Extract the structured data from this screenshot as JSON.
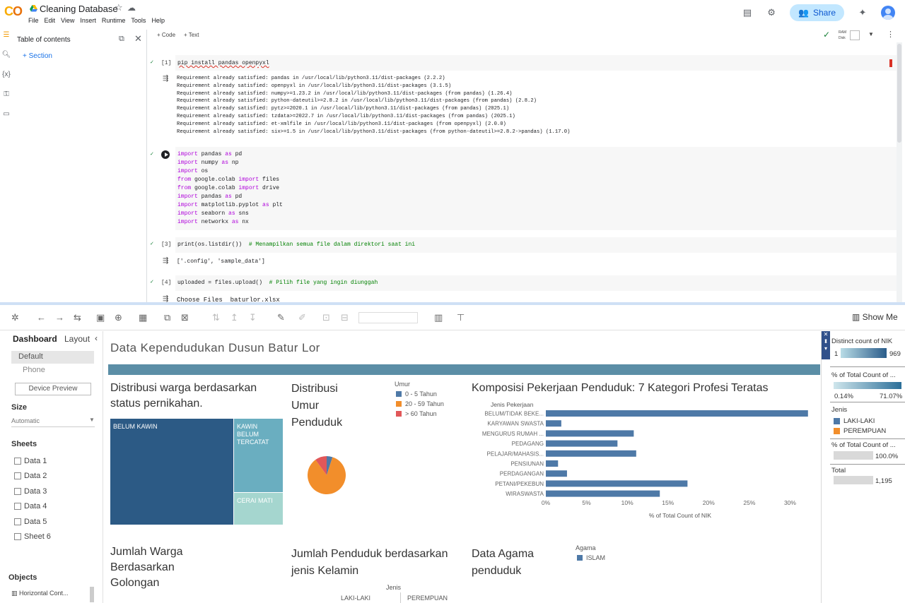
{
  "colab": {
    "title": "Cleaning Database",
    "menu": [
      "File",
      "Edit",
      "View",
      "Insert",
      "Runtime",
      "Tools",
      "Help"
    ],
    "share_label": "Share",
    "toc": {
      "title": "Table of contents",
      "section": "+ Section"
    },
    "toolbar": {
      "add_code": "+ Code",
      "add_text": "+ Text",
      "ram": "RAM",
      "disk": "Disk"
    },
    "cells": [
      {
        "number": "[1]",
        "ran": "✓",
        "code": [
          "pip install pandas openpyxl"
        ],
        "output": [
          "Requirement already satisfied: pandas in /usr/local/lib/python3.11/dist-packages (2.2.2)",
          "Requirement already satisfied: openpyxl in /usr/local/lib/python3.11/dist-packages (3.1.5)",
          "Requirement already satisfied: numpy>=1.23.2 in /usr/local/lib/python3.11/dist-packages (from pandas) (1.26.4)",
          "Requirement already satisfied: python-dateutil>=2.8.2 in /usr/local/lib/python3.11/dist-packages (from pandas) (2.8.2)",
          "Requirement already satisfied: pytz>=2020.1 in /usr/local/lib/python3.11/dist-packages (from pandas) (2025.1)",
          "Requirement already satisfied: tzdata>=2022.7 in /usr/local/lib/python3.11/dist-packages (from pandas) (2025.1)",
          "Requirement already satisfied: et-xmlfile in /usr/local/lib/python3.11/dist-packages (from openpyxl) (2.0.0)",
          "Requirement already satisfied: six>=1.5 in /usr/local/lib/python3.11/dist-packages (from python-dateutil>=2.8.2->pandas) (1.17.0)"
        ]
      },
      {
        "number": "",
        "ran": "✓",
        "code": [
          "import pandas as pd",
          "import numpy as np",
          "import os",
          "from google.colab import files",
          "from google.colab import drive",
          "import pandas as pd",
          "import matplotlib.pyplot as plt",
          "import seaborn as sns",
          "import networkx as nx"
        ],
        "output": []
      },
      {
        "number": "[3]",
        "ran": "✓",
        "code": [
          "print(os.listdir())  # Menampilkan semua file dalam direktori saat ini"
        ],
        "output": [
          "['.config', 'sample_data']"
        ]
      },
      {
        "number": "[4]",
        "ran": "✓",
        "code": [
          "uploaded = files.upload()  # Pilih file yang ingin diunggah"
        ],
        "output": [
          "Choose Files  baturlor.xlsx"
        ]
      }
    ]
  },
  "tableau": {
    "show_me": "Show Me",
    "tabs": {
      "dashboard": "Dashboard",
      "layout": "Layout"
    },
    "device": {
      "default": "Default",
      "phone": "Phone",
      "preview": "Device Preview"
    },
    "size": {
      "label": "Size",
      "value": "Automatic"
    },
    "sheets_label": "Sheets",
    "sheets": [
      "Data 1",
      "Data 2",
      "Data 3",
      "Data 4",
      "Data 5",
      "Sheet 6"
    ],
    "objects_label": "Objects",
    "objects_item": "Horizontal Cont...",
    "dashboard_title": "Data Kependudukan Dusun Batur Lor",
    "sections": {
      "marital": "Distribusi warga berdasarkan status pernikahan.",
      "age": "Distribusi Umur Penduduk",
      "occupation": "Komposisi Pekerjaan Penduduk: 7 Kategori Profesi Teratas",
      "education": "Jumlah Warga Berdasarkan Golongan",
      "gender": "Jumlah Penduduk berdasarkan jenis Kelamin",
      "religion": "Data Agama penduduk"
    },
    "treemap": [
      {
        "label": "BELUM KAWIN",
        "color": "#2c5a85"
      },
      {
        "label": "KAWIN BELUM TERCATAT",
        "color": "#6aaec0"
      },
      {
        "label": "CERAI MATI",
        "color": "#a5d6cf"
      }
    ],
    "age_legend": {
      "title": "Umur",
      "items": [
        {
          "label": "0 - 5 Tahun",
          "color": "#4e79a7"
        },
        {
          "label": "20 - 59 Tahun",
          "color": "#f28e2b"
        },
        {
          "label": "> 60 Tahun",
          "color": "#e15759"
        }
      ]
    },
    "gender_header": "Jenis",
    "gender_cols": [
      "LAKI-LAKI",
      "PEREMPUAN"
    ],
    "religion_legend": {
      "title": "Agama",
      "item": "ISLAM",
      "color": "#4e79a7"
    },
    "right_panel": {
      "nik_title": "Distinct count of NIK",
      "nik_min": "1",
      "nik_max": "969",
      "pct_title": "% of Total Count of ...",
      "pct_min": "0.14%",
      "pct_max": "71.07%",
      "jenis_title": "Jenis",
      "jenis_items": [
        "LAKI-LAKI",
        "PEREMPUAN"
      ],
      "jenis_colors": [
        "#4e79a7",
        "#f28e2b"
      ],
      "pct2_title": "% of Total Count of ...",
      "pct2_val": "100.0%",
      "total_title": "Total",
      "total_val": "1,195"
    }
  },
  "chart_data": [
    {
      "type": "pie",
      "title": "Distribusi Umur Penduduk",
      "categories": [
        "0 - 5 Tahun",
        "20 - 59 Tahun",
        "> 60 Tahun"
      ],
      "values": [
        5,
        85,
        10
      ],
      "colors": [
        "#4e79a7",
        "#f28e2b",
        "#e15759"
      ]
    },
    {
      "type": "bar",
      "orientation": "horizontal",
      "title": "Komposisi Pekerjaan Penduduk: 7 Kategori Profesi Teratas",
      "ylabel": "Jenis Pekerjaan",
      "xlabel": "% of Total Count of NIK",
      "categories": [
        "BELUM/TIDAK BEKE...",
        "KARYAWAN SWASTA",
        "MENGURUS RUMAH ...",
        "PEDAGANG",
        "PELAJAR/MAHASIS...",
        "PENSIUNAN",
        "PERDAGANGAN",
        "PETANI/PEKEBUN",
        "WIRASWASTA"
      ],
      "values": [
        32.2,
        1.9,
        10.8,
        8.8,
        11.1,
        1.5,
        2.6,
        17.4,
        14.0
      ],
      "xticks": [
        "0%",
        "5%",
        "10%",
        "15%",
        "20%",
        "25%",
        "30%"
      ],
      "xlim": [
        0,
        33
      ],
      "color": "#4e79a7"
    }
  ]
}
